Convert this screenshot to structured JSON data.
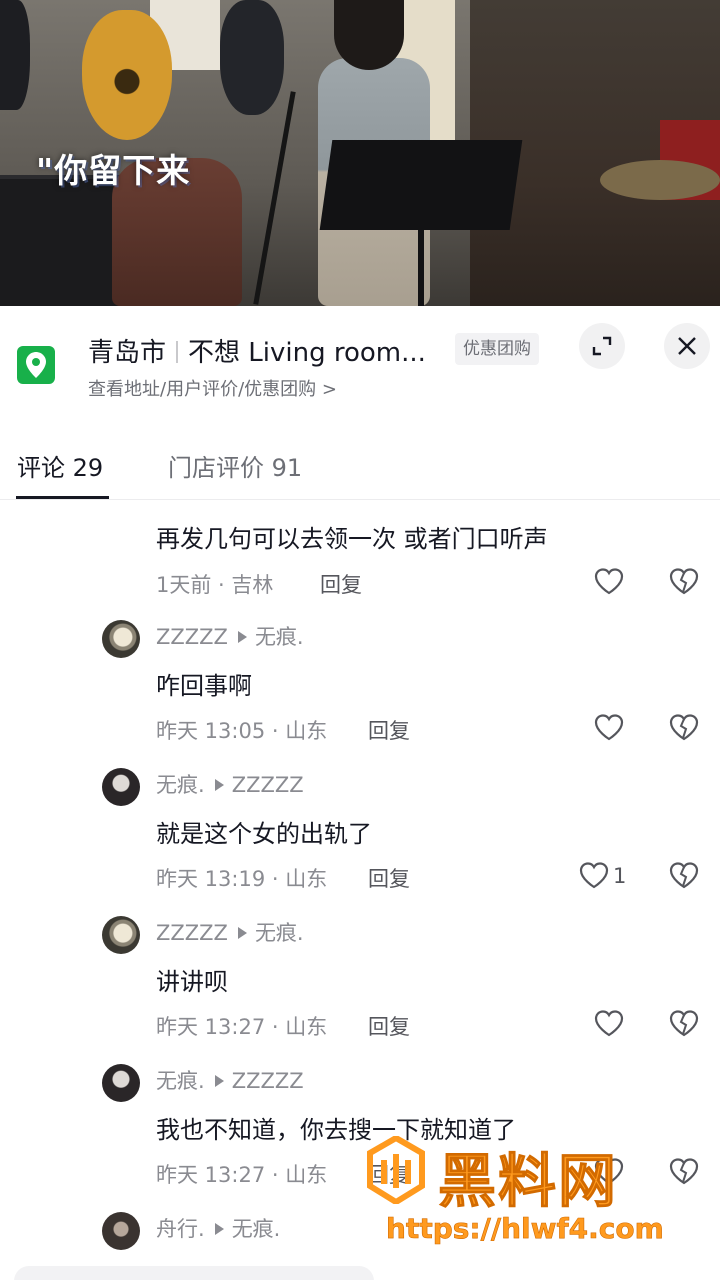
{
  "video": {
    "lyric": "\"你留下来"
  },
  "poi": {
    "city": "青岛市",
    "shop_name": "不想 Living room...",
    "subtitle": "查看地址/用户评价/优惠团购 >",
    "badge": "优惠团购",
    "expand_icon": "expand-icon",
    "close_icon": "close-icon",
    "accent_color": "#18b04a"
  },
  "tabs": [
    {
      "label": "评论 29",
      "active": true
    },
    {
      "label": "门店评价 91",
      "active": false
    }
  ],
  "comments": [
    {
      "text": "再发几句可以去领一次 或者门口听声",
      "meta": "1天前 · 吉林",
      "reply": "回复",
      "likes": ""
    },
    {
      "author": "ZZZZZ",
      "reply_to": "无痕.",
      "text": "咋回事啊",
      "meta": "昨天 13:05 · 山东",
      "reply": "回复",
      "likes": ""
    },
    {
      "author": "无痕.",
      "reply_to": "ZZZZZ",
      "text": "就是这个女的出轨了",
      "meta": "昨天 13:19 · 山东",
      "reply": "回复",
      "likes": "1"
    },
    {
      "author": "ZZZZZ",
      "reply_to": "无痕.",
      "text": "讲讲呗",
      "meta": "昨天 13:27 · 山东",
      "reply": "回复",
      "likes": ""
    },
    {
      "author": "无痕.",
      "reply_to": "ZZZZZ",
      "text": "我也不知道，你去搜一下就知道了",
      "meta": "昨天 13:27 · 山东",
      "reply": "回复",
      "likes": ""
    },
    {
      "author": "舟行.",
      "reply_to": "无痕."
    }
  ],
  "watermark": {
    "name": "黑料网",
    "url": "https://hlwf4.com",
    "color": "#ff9a1e"
  }
}
